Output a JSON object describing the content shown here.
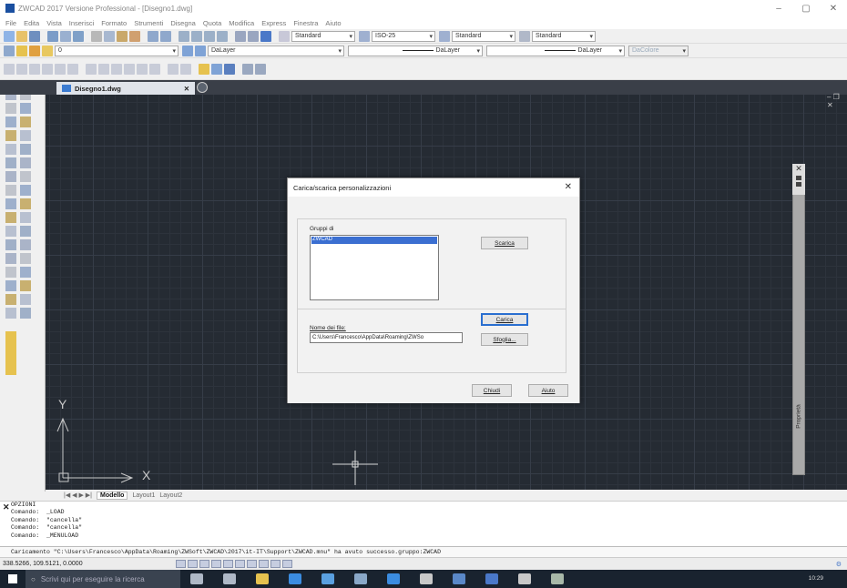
{
  "window": {
    "title": "ZWCAD 2017 Versione Professional - [Disegno1.dwg]",
    "controls": [
      "–",
      "▢",
      "✕"
    ]
  },
  "menu": [
    "File",
    "Edita",
    "Vista",
    "Inserisci",
    "Formato",
    "Strumenti",
    "Disegna",
    "Quota",
    "Modifica",
    "Express",
    "Finestra",
    "Aiuto"
  ],
  "toolbar1": {
    "textstyle": "Standard",
    "dimstyle": "ISO-25",
    "tablestyle": "Standard",
    "mleaderstyle": "Standard"
  },
  "toolbar2": {
    "layer": "0",
    "color_layer": "DaLayer",
    "linetype": "DaLayer",
    "lineweight": "DaLayer",
    "plotstyle": "DaColore"
  },
  "document_tab": {
    "name": "Disegno1.dwg",
    "close": "✕"
  },
  "canvas_controls": "– ❐ ✕",
  "properties_panel": {
    "label": "Proprietà"
  },
  "ucs": {
    "y": "Y",
    "x": "X"
  },
  "model_tabs": {
    "nav": "|◀ ◀ ▶ ▶|",
    "model": "Modello",
    "layouts": [
      "Layout1",
      "Layout2"
    ]
  },
  "command_log": [
    "OPZIONI",
    "Comando:  _LOAD",
    "Comando:  \"cancella\"",
    "Comando:  \"cancella\"",
    "Comando:  _MENULOAD"
  ],
  "command_line": "Caricamento \"C:\\Users\\Francesco\\AppData\\Roaming\\ZWSoft\\ZWCAD\\2017\\it-IT\\Support\\ZWCAD.mnu\" ha avuto successo.gruppo:ZWCAD",
  "status": {
    "coords": "338.5266, 109.5121, 0.0000"
  },
  "taskbar": {
    "search_placeholder": "Scrivi qui per eseguire la ricerca",
    "time": "10:29"
  },
  "dialog": {
    "title": "Carica/scarica personalizzazioni",
    "close": "✕",
    "group_label": "Gruppi di",
    "groups": [
      "ZWCAD"
    ],
    "btn_scarica": "Scarica",
    "btn_carica": "Carica",
    "file_label": "Nome dei file:",
    "file_value": "C:\\Users\\Francesco\\AppData\\Roaming\\ZWSo",
    "btn_sfoglia": "Sfoglia...",
    "btn_chiudi": "Chiudi",
    "btn_aiuto": "Aiuto"
  },
  "colors": {
    "canvas": "#252b33",
    "grid": "#363d48",
    "accent": "#3b6fd1",
    "taskbar": "#19232f"
  }
}
